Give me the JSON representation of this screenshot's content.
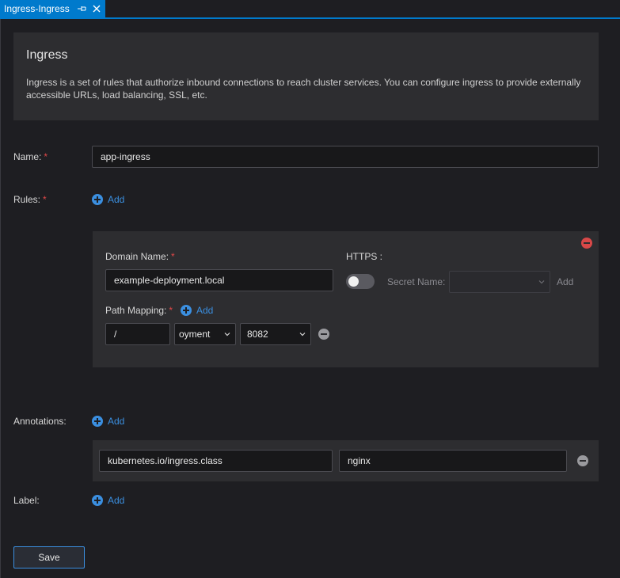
{
  "tab": {
    "title": "Ingress-Ingress",
    "pin_icon": "pin-icon",
    "close_icon": "close-icon"
  },
  "info": {
    "title": "Ingress",
    "description": "Ingress is a set of rules that authorize inbound connections to reach cluster services. You can configure ingress to provide externally accessible URLs, load balancing, SSL, etc."
  },
  "form": {
    "name_label": "Name:",
    "required_mark": "*",
    "name_value": "app-ingress",
    "rules_label": "Rules:",
    "add_label": "Add",
    "annotations_label": "Annotations:",
    "label_label": "Label:"
  },
  "rule": {
    "domain_label": "Domain Name:",
    "domain_value": "example-deployment.local",
    "https_label": "HTTPS :",
    "https_enabled": false,
    "secret_label": "Secret Name:",
    "secret_value": "",
    "secret_add_label": "Add",
    "path_mapping_label": "Path Mapping:",
    "path_value": "/",
    "service_value": "oyment",
    "port_value": "8082"
  },
  "annotation": {
    "key": "kubernetes.io/ingress.class",
    "value": "nginx"
  },
  "actions": {
    "save_label": "Save"
  },
  "colors": {
    "accent": "#007acc",
    "link": "#3b8fe0",
    "required": "#e04848",
    "remove": "#d84848"
  }
}
